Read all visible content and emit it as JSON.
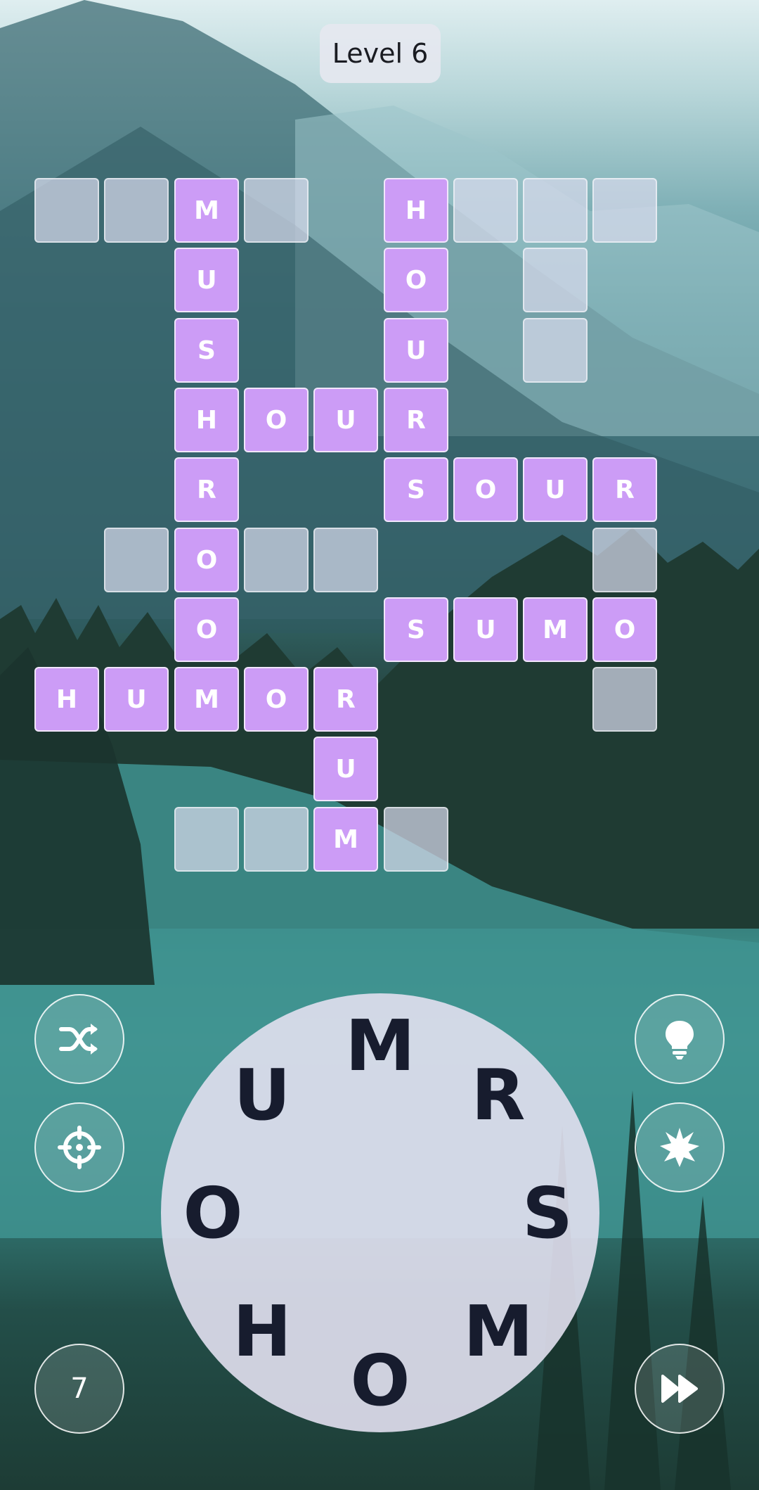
{
  "header": {
    "level_label": "Level 6"
  },
  "grid": {
    "cells": [
      {
        "r": 0,
        "c": 0,
        "letter": ""
      },
      {
        "r": 0,
        "c": 1,
        "letter": ""
      },
      {
        "r": 0,
        "c": 2,
        "letter": "M"
      },
      {
        "r": 0,
        "c": 3,
        "letter": ""
      },
      {
        "r": 0,
        "c": 5,
        "letter": "H"
      },
      {
        "r": 0,
        "c": 6,
        "letter": ""
      },
      {
        "r": 0,
        "c": 7,
        "letter": ""
      },
      {
        "r": 0,
        "c": 8,
        "letter": ""
      },
      {
        "r": 1,
        "c": 2,
        "letter": "U"
      },
      {
        "r": 1,
        "c": 5,
        "letter": "O"
      },
      {
        "r": 1,
        "c": 7,
        "letter": ""
      },
      {
        "r": 2,
        "c": 2,
        "letter": "S"
      },
      {
        "r": 2,
        "c": 5,
        "letter": "U"
      },
      {
        "r": 2,
        "c": 7,
        "letter": ""
      },
      {
        "r": 3,
        "c": 2,
        "letter": "H"
      },
      {
        "r": 3,
        "c": 3,
        "letter": "O"
      },
      {
        "r": 3,
        "c": 4,
        "letter": "U"
      },
      {
        "r": 3,
        "c": 5,
        "letter": "R"
      },
      {
        "r": 4,
        "c": 2,
        "letter": "R"
      },
      {
        "r": 4,
        "c": 5,
        "letter": "S"
      },
      {
        "r": 4,
        "c": 6,
        "letter": "O"
      },
      {
        "r": 4,
        "c": 7,
        "letter": "U"
      },
      {
        "r": 4,
        "c": 8,
        "letter": "R"
      },
      {
        "r": 5,
        "c": 1,
        "letter": ""
      },
      {
        "r": 5,
        "c": 2,
        "letter": "O"
      },
      {
        "r": 5,
        "c": 3,
        "letter": ""
      },
      {
        "r": 5,
        "c": 4,
        "letter": ""
      },
      {
        "r": 5,
        "c": 8,
        "letter": ""
      },
      {
        "r": 6,
        "c": 2,
        "letter": "O"
      },
      {
        "r": 6,
        "c": 5,
        "letter": "S"
      },
      {
        "r": 6,
        "c": 6,
        "letter": "U"
      },
      {
        "r": 6,
        "c": 7,
        "letter": "M"
      },
      {
        "r": 6,
        "c": 8,
        "letter": "O"
      },
      {
        "r": 7,
        "c": 0,
        "letter": "H"
      },
      {
        "r": 7,
        "c": 1,
        "letter": "U"
      },
      {
        "r": 7,
        "c": 2,
        "letter": "M"
      },
      {
        "r": 7,
        "c": 3,
        "letter": "O"
      },
      {
        "r": 7,
        "c": 4,
        "letter": "R"
      },
      {
        "r": 7,
        "c": 8,
        "letter": ""
      },
      {
        "r": 8,
        "c": 4,
        "letter": "U"
      },
      {
        "r": 9,
        "c": 2,
        "letter": ""
      },
      {
        "r": 9,
        "c": 3,
        "letter": ""
      },
      {
        "r": 9,
        "c": 4,
        "letter": "M"
      },
      {
        "r": 9,
        "c": 5,
        "letter": ""
      }
    ]
  },
  "wheel": {
    "letters": [
      "M",
      "R",
      "S",
      "M",
      "O",
      "H",
      "O",
      "U"
    ]
  },
  "controls": {
    "shuffle_icon": "shuffle-icon",
    "target_icon": "crosshair-icon",
    "hint_icon": "lightbulb-icon",
    "burst_icon": "burst-icon",
    "skip_icon": "fast-forward-icon",
    "count_label": "7"
  },
  "colors": {
    "filled": "#cc9cf6",
    "empty": "#d7daeb",
    "wheel_letter": "#171c2e"
  }
}
